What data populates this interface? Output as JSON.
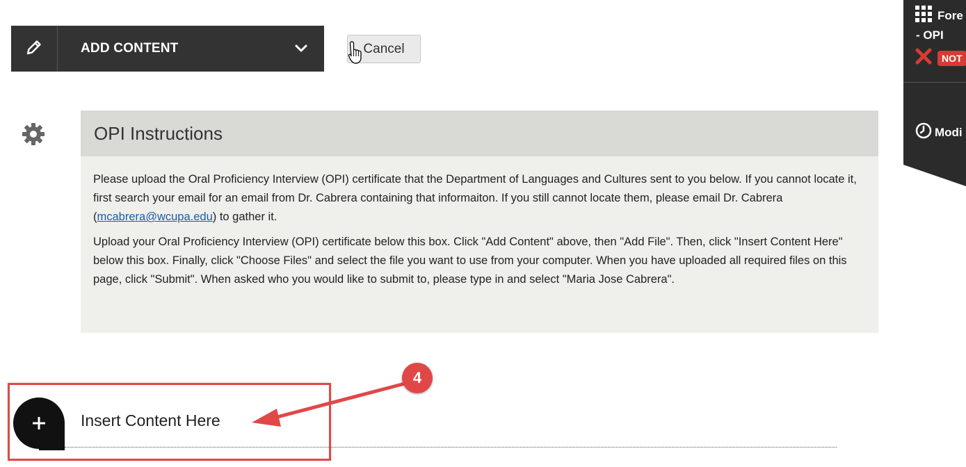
{
  "toolbar": {
    "add_content_label": "ADD CONTENT",
    "cancel_label": "Cancel",
    "edit_icon": "pencil-icon",
    "dropdown_icon": "chevron-down-icon"
  },
  "side_panel": {
    "title": "Fore",
    "subtitle": "- OPI",
    "status_badge": "NOT",
    "modified_label": "Modi",
    "grid_icon": "grid-icon",
    "status_icon": "x-icon",
    "clock_icon": "clock-icon"
  },
  "instructions": {
    "title": "OPI Instructions",
    "p1_before": "Please upload the Oral Proficiency Interview (OPI) certificate that the Department of Languages and Cultures sent to you below.  If you cannot locate it, first search your email for an email from Dr. Cabrera containing that informaiton.  If you still cannot locate them, please email Dr. Cabrera (",
    "p1_link": "mcabrera@wcupa.edu",
    "p1_after": ") to gather it.",
    "p2": "Upload your Oral Proficiency Interview (OPI) certificate below this box.  Click \"Add Content\" above, then \"Add File\".  Then, click \"Insert Content Here\" below this box.  Finally, click \"Choose Files\" and select the file you want to use from your computer.  When you have uploaded all required files on this page, click \"Submit\".  When asked who you would like to submit to, please type in and select \"Maria Jose Cabrera\"."
  },
  "insert": {
    "label": "Insert Content Here",
    "plus_icon": "plus-icon"
  },
  "annotation": {
    "step_number": "4",
    "color": "#e04848"
  },
  "colors": {
    "toolbar_bg": "#333333",
    "panel_bg": "#2b2b2b",
    "instr_header_bg": "#d9d9d5",
    "instr_body_bg": "#efefec",
    "link": "#1a5ea6",
    "badge": "#d83a36"
  }
}
